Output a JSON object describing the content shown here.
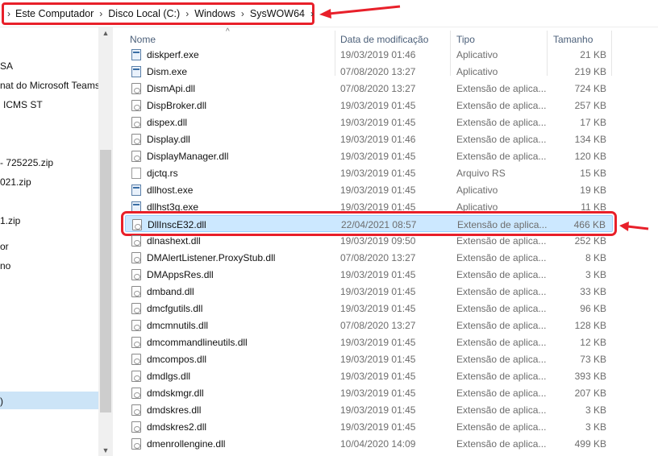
{
  "breadcrumb": {
    "items": [
      "Este Computador",
      "Disco Local (C:)",
      "Windows",
      "SysWOW64"
    ]
  },
  "nav": {
    "items": [
      "SA",
      "nat do Microsoft Teams",
      "ICMS ST",
      "- 725225.zip",
      "021.zip",
      "1.zip",
      "or",
      "no",
      ")"
    ]
  },
  "columns": {
    "name": "Nome",
    "date": "Data de modificação",
    "type": "Tipo",
    "size": "Tamanho"
  },
  "files": [
    {
      "name": "diskperf.exe",
      "date": "19/03/2019 01:46",
      "type": "Aplicativo",
      "size": "21 KB",
      "icon": "exe"
    },
    {
      "name": "Dism.exe",
      "date": "07/08/2020 13:27",
      "type": "Aplicativo",
      "size": "219 KB",
      "icon": "exe"
    },
    {
      "name": "DismApi.dll",
      "date": "07/08/2020 13:27",
      "type": "Extensão de aplica...",
      "size": "724 KB",
      "icon": "dll"
    },
    {
      "name": "DispBroker.dll",
      "date": "19/03/2019 01:45",
      "type": "Extensão de aplica...",
      "size": "257 KB",
      "icon": "dll"
    },
    {
      "name": "dispex.dll",
      "date": "19/03/2019 01:45",
      "type": "Extensão de aplica...",
      "size": "17 KB",
      "icon": "dll"
    },
    {
      "name": "Display.dll",
      "date": "19/03/2019 01:46",
      "type": "Extensão de aplica...",
      "size": "134 KB",
      "icon": "dll"
    },
    {
      "name": "DisplayManager.dll",
      "date": "19/03/2019 01:45",
      "type": "Extensão de aplica...",
      "size": "120 KB",
      "icon": "dll"
    },
    {
      "name": "djctq.rs",
      "date": "19/03/2019 01:45",
      "type": "Arquivo RS",
      "size": "15 KB",
      "icon": "rs"
    },
    {
      "name": "dllhost.exe",
      "date": "19/03/2019 01:45",
      "type": "Aplicativo",
      "size": "19 KB",
      "icon": "exe"
    },
    {
      "name": "dllhst3g.exe",
      "date": "19/03/2019 01:45",
      "type": "Aplicativo",
      "size": "11 KB",
      "icon": "exe"
    },
    {
      "name": "DllInscE32.dll",
      "date": "22/04/2021 08:57",
      "type": "Extensão de aplica...",
      "size": "466 KB",
      "icon": "dll",
      "selected": true
    },
    {
      "name": "dlnashext.dll",
      "date": "19/03/2019 09:50",
      "type": "Extensão de aplica...",
      "size": "252 KB",
      "icon": "dll"
    },
    {
      "name": "DMAlertListener.ProxyStub.dll",
      "date": "07/08/2020 13:27",
      "type": "Extensão de aplica...",
      "size": "8 KB",
      "icon": "dll"
    },
    {
      "name": "DMAppsRes.dll",
      "date": "19/03/2019 01:45",
      "type": "Extensão de aplica...",
      "size": "3 KB",
      "icon": "dll"
    },
    {
      "name": "dmband.dll",
      "date": "19/03/2019 01:45",
      "type": "Extensão de aplica...",
      "size": "33 KB",
      "icon": "dll"
    },
    {
      "name": "dmcfgutils.dll",
      "date": "19/03/2019 01:45",
      "type": "Extensão de aplica...",
      "size": "96 KB",
      "icon": "dll"
    },
    {
      "name": "dmcmnutils.dll",
      "date": "07/08/2020 13:27",
      "type": "Extensão de aplica...",
      "size": "128 KB",
      "icon": "dll"
    },
    {
      "name": "dmcommandlineutils.dll",
      "date": "19/03/2019 01:45",
      "type": "Extensão de aplica...",
      "size": "12 KB",
      "icon": "dll"
    },
    {
      "name": "dmcompos.dll",
      "date": "19/03/2019 01:45",
      "type": "Extensão de aplica...",
      "size": "73 KB",
      "icon": "dll"
    },
    {
      "name": "dmdlgs.dll",
      "date": "19/03/2019 01:45",
      "type": "Extensão de aplica...",
      "size": "393 KB",
      "icon": "dll"
    },
    {
      "name": "dmdskmgr.dll",
      "date": "19/03/2019 01:45",
      "type": "Extensão de aplica...",
      "size": "207 KB",
      "icon": "dll"
    },
    {
      "name": "dmdskres.dll",
      "date": "19/03/2019 01:45",
      "type": "Extensão de aplica...",
      "size": "3 KB",
      "icon": "dll"
    },
    {
      "name": "dmdskres2.dll",
      "date": "19/03/2019 01:45",
      "type": "Extensão de aplica...",
      "size": "3 KB",
      "icon": "dll"
    },
    {
      "name": "dmenrollengine.dll",
      "date": "10/04/2020 14:09",
      "type": "Extensão de aplica...",
      "size": "499 KB",
      "icon": "dll"
    }
  ],
  "colors": {
    "annotation_red": "#e8202a",
    "selection_bg": "#cce8ff"
  }
}
